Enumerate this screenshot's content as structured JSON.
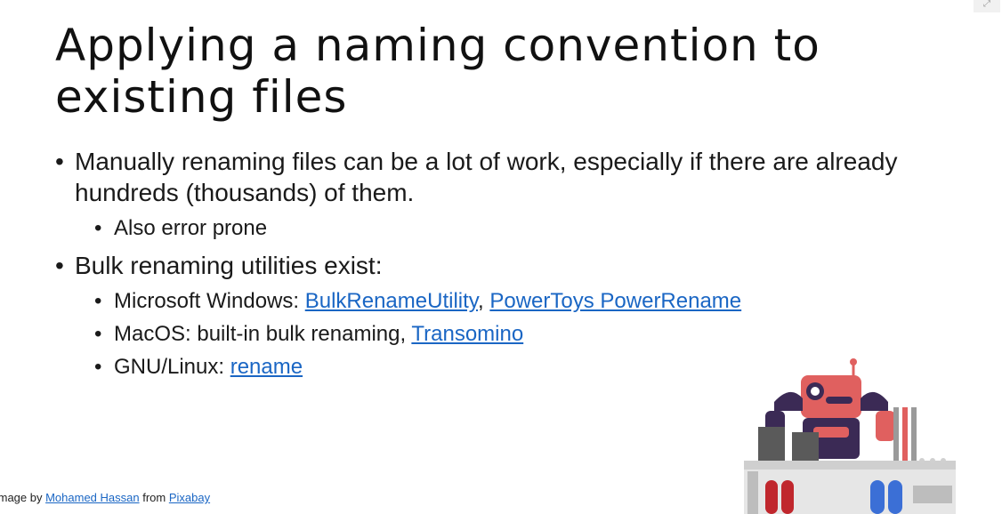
{
  "slide": {
    "title": "Applying a naming convention to existing files",
    "bullets": [
      {
        "text": "Manually renaming files can be a lot of work, especially if there are already hundreds (thousands) of them.",
        "sub": [
          {
            "text": "Also error prone"
          }
        ]
      },
      {
        "text": "Bulk renaming utilities exist:",
        "sub": [
          {
            "prefix": "Microsoft Windows: ",
            "link1": "BulkRenameUtility",
            "sep": ", ",
            "link2": "PowerToys PowerRename"
          },
          {
            "prefix": "MacOS: built-in bulk renaming, ",
            "link1": "Transomino"
          },
          {
            "prefix": "GNU/Linux: ",
            "link1": "rename"
          }
        ]
      }
    ]
  },
  "credit": {
    "prefix": "Image by ",
    "author": "Mohamed Hassan",
    "middle": " from ",
    "source": "Pixabay"
  },
  "illustration": {
    "name": "robot-factory-illustration"
  },
  "colors": {
    "link": "#1a66c4",
    "robot_body": "#e0605f",
    "robot_dark": "#3b2a55"
  },
  "icons": {
    "expand": "expand-icon"
  }
}
